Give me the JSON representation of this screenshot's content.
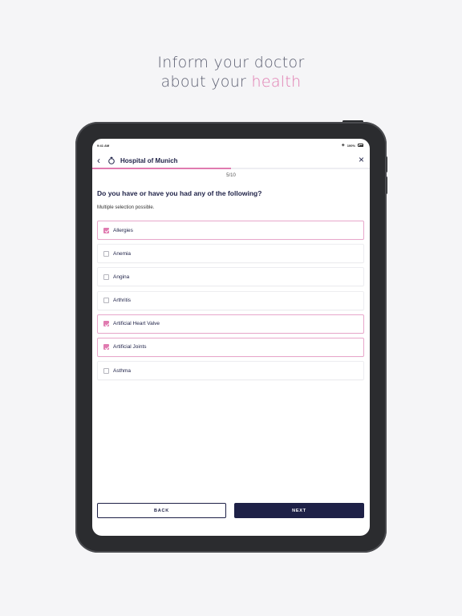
{
  "headline": {
    "line1": "Inform your doctor",
    "line2_prefix": "about your ",
    "line2_accent": "health"
  },
  "colors": {
    "accent": "#e07bb0",
    "primary": "#1e2147",
    "background": "#f5f5f7"
  },
  "statusbar": {
    "time": "9:41 AM",
    "battery": "100%"
  },
  "header": {
    "title": "Hospital of Munich",
    "back_icon": "chevron-left-icon",
    "close_icon": "close-icon"
  },
  "progress": {
    "step": "5/10",
    "fraction": 0.5
  },
  "question": {
    "text": "Do you have or have you had any of the following?",
    "hint": "Multiple selection possible."
  },
  "options": [
    {
      "label": "Allergies",
      "selected": true
    },
    {
      "label": "Anemia",
      "selected": false
    },
    {
      "label": "Angina",
      "selected": false
    },
    {
      "label": "Arthritis",
      "selected": false
    },
    {
      "label": "Artificial Heart Valve",
      "selected": true
    },
    {
      "label": "Artificial Joints",
      "selected": true
    },
    {
      "label": "Asthma",
      "selected": false
    }
  ],
  "buttons": {
    "back": "BACK",
    "next": "NEXT"
  }
}
